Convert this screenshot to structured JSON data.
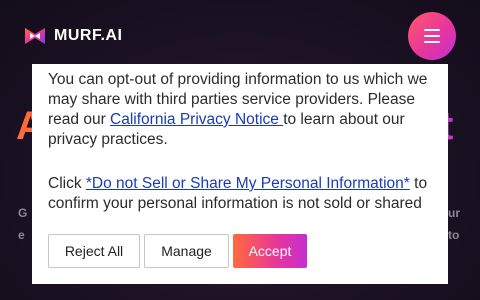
{
  "site": {
    "logo_text": "MURF.AI",
    "hero_left": "A",
    "hero_right": "t",
    "sub_left_1": "G",
    "sub_left_2": "e",
    "sub_right_1": "ur",
    "sub_right_2": "to"
  },
  "consent": {
    "p1_before": "You can opt-out of providing information to us which we may share with third parties service providers. Please read our ",
    "p1_link": "California Privacy Notice ",
    "p1_after": "to learn about our privacy practices.",
    "p2_before": "Click ",
    "p2_link": "*Do not Sell or Share My Personal Information*",
    "p2_after": " to confirm your personal information is not sold or shared",
    "reject_label": "Reject All",
    "manage_label": "Manage",
    "accept_label": "Accept"
  },
  "icons": {
    "logo": "murf-logo-icon",
    "menu": "hamburger-menu-icon"
  },
  "colors": {
    "accent_start": "#ff6a3d",
    "accent_mid": "#e8359c",
    "accent_end": "#c32fcf",
    "link": "#1a3bb8",
    "page_bg": "#1c1324"
  }
}
